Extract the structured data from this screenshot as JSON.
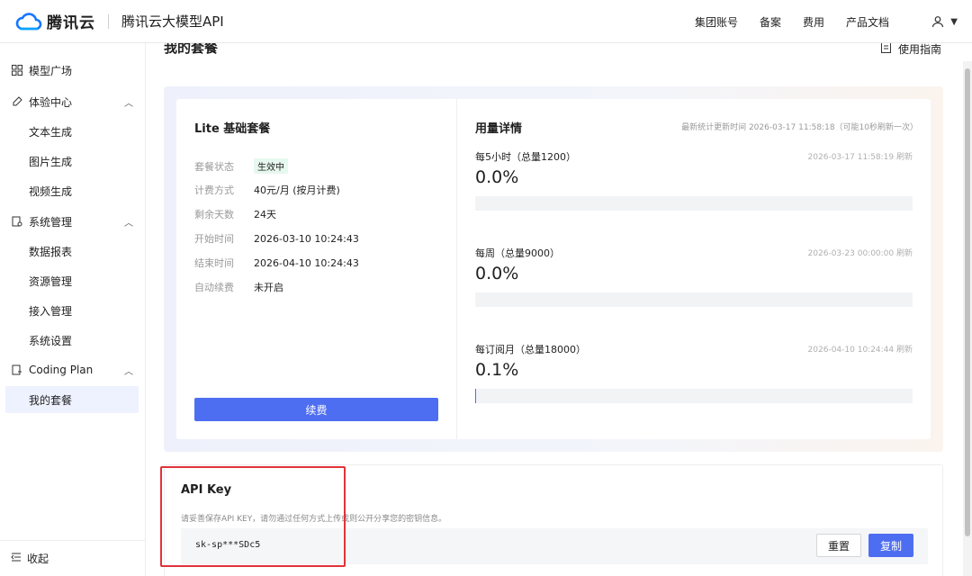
{
  "header": {
    "logo_text": "腾讯云",
    "product_title": "腾讯云大模型API",
    "nav": [
      "集团账号",
      "备案",
      "费用",
      "产品文档"
    ]
  },
  "sidebar": {
    "items": [
      {
        "label": "模型广场",
        "icon": "grid-icon"
      },
      {
        "label": "体验中心",
        "icon": "experience-icon"
      },
      {
        "label": "文本生成"
      },
      {
        "label": "图片生成"
      },
      {
        "label": "视频生成"
      },
      {
        "label": "系统管理",
        "icon": "settings-doc-icon"
      },
      {
        "label": "数据报表"
      },
      {
        "label": "资源管理"
      },
      {
        "label": "接入管理"
      },
      {
        "label": "系统设置"
      },
      {
        "label": "Coding Plan",
        "icon": "plan-icon"
      },
      {
        "label": "我的套餐"
      }
    ],
    "collapse_label": "收起"
  },
  "main": {
    "page_title": "我的套餐",
    "guide_label": "使用指南"
  },
  "plan": {
    "title": "Lite 基础套餐",
    "rows": [
      {
        "key": "套餐状态",
        "value": "生效中"
      },
      {
        "key": "计费方式",
        "value": "40元/月 (按月计费)"
      },
      {
        "key": "剩余天数",
        "value": "24天"
      },
      {
        "key": "开始时间",
        "value": "2026-03-10 10:24:43"
      },
      {
        "key": "结束时间",
        "value": "2026-04-10 10:24:43"
      },
      {
        "key": "自动续费",
        "value": "未开启"
      }
    ],
    "renew_label": "续费"
  },
  "usage": {
    "title": "用量详情",
    "stat_time": "最新统计更新时间 2026-03-17 11:58:18（可能10秒刷新一次）",
    "items": [
      {
        "label": "每5小时（总量1200）",
        "time": "2026-03-17 11:58:19 刷新",
        "percent_text": "0.0%",
        "percent": 0.0
      },
      {
        "label": "每周（总量9000）",
        "time": "2026-03-23 00:00:00 刷新",
        "percent_text": "0.0%",
        "percent": 0.0
      },
      {
        "label": "每订阅月（总量18000）",
        "time": "2026-04-10 10:24:44 刷新",
        "percent_text": "0.1%",
        "percent": 0.1
      }
    ]
  },
  "api_key": {
    "title": "API Key",
    "description": "请妥善保存API KEY，请勿通过任何方式上传或则公开分享您的密钥信息。",
    "value": "sk-sp***SDc5",
    "reset_label": "重置",
    "copy_label": "复制"
  },
  "colors": {
    "accent": "#4e6ef2",
    "status_green": "#1aa34a",
    "highlight_red": "#e0333a"
  }
}
